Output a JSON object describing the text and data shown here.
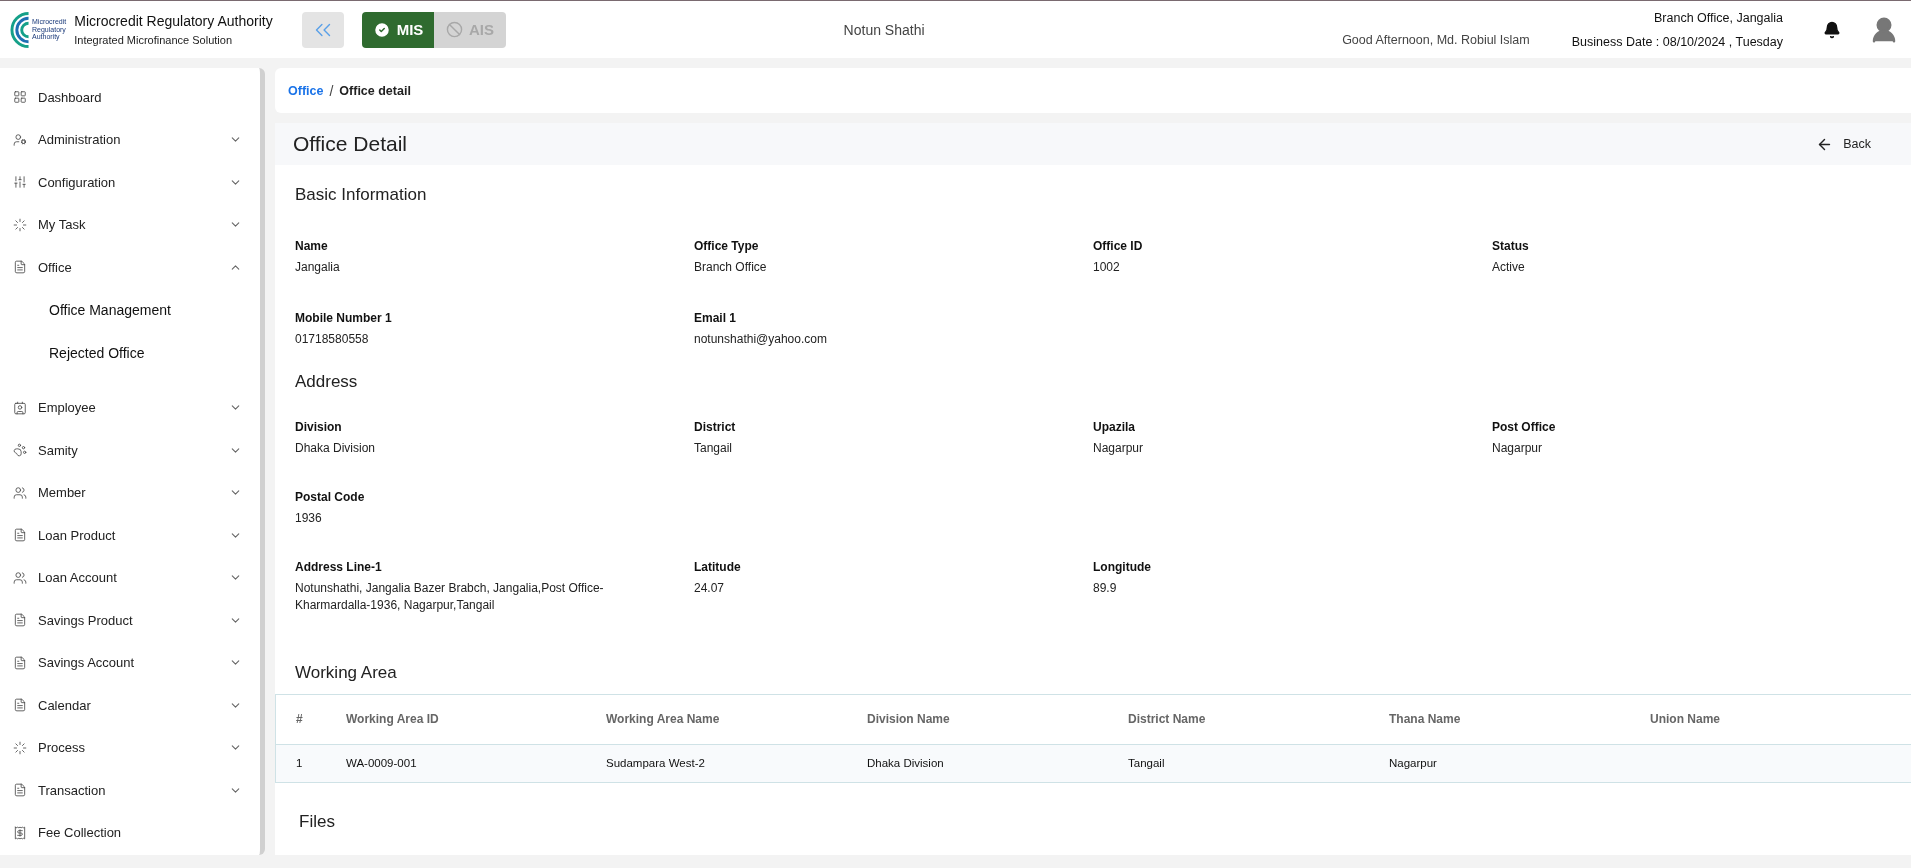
{
  "header": {
    "logo_title": "Microcredit Regulatory Authority",
    "logo_subtitle": "Integrated Microfinance Solution",
    "logo_mark_lines": [
      "Microcredit",
      "Regulatory",
      "Authority"
    ],
    "module_tabs": [
      {
        "label": "MIS",
        "selected": true
      },
      {
        "label": "AIS",
        "selected": false
      }
    ],
    "org_name": "Notun Shathi",
    "greeting": "Good Afternoon, Md. Robiul Islam",
    "branch": "Branch Office, Jangalia",
    "business_date": "Business Date : 08/10/2024 , Tuesday"
  },
  "sidebar": {
    "items": [
      {
        "label": "Dashboard",
        "kind": "link"
      },
      {
        "label": "Administration",
        "kind": "group",
        "expanded": false
      },
      {
        "label": "Configuration",
        "kind": "group",
        "expanded": false
      },
      {
        "label": "My Task",
        "kind": "group",
        "expanded": false
      },
      {
        "label": "Office",
        "kind": "group",
        "expanded": true,
        "children": [
          {
            "label": "Office Management"
          },
          {
            "label": "Rejected Office"
          }
        ]
      },
      {
        "label": "Employee",
        "kind": "group",
        "expanded": false
      },
      {
        "label": "Samity",
        "kind": "group",
        "expanded": false
      },
      {
        "label": "Member",
        "kind": "group",
        "expanded": false
      },
      {
        "label": "Loan Product",
        "kind": "group",
        "expanded": false
      },
      {
        "label": "Loan Account",
        "kind": "group",
        "expanded": false
      },
      {
        "label": "Savings Product",
        "kind": "group",
        "expanded": false
      },
      {
        "label": "Savings Account",
        "kind": "group",
        "expanded": false
      },
      {
        "label": "Calendar",
        "kind": "group",
        "expanded": false
      },
      {
        "label": "Process",
        "kind": "group",
        "expanded": false
      },
      {
        "label": "Transaction",
        "kind": "group",
        "expanded": false
      },
      {
        "label": "Fee Collection",
        "kind": "link"
      }
    ]
  },
  "breadcrumb": [
    {
      "label": "Office",
      "kind": "link"
    },
    {
      "label": "Office detail",
      "kind": "current"
    }
  ],
  "breadcrumb_separator": "/",
  "page": {
    "title": "Office Detail",
    "back_label": "Back"
  },
  "sections": [
    {
      "title": "Basic Information",
      "rows": [
        [
          {
            "label": "Name",
            "value": "Jangalia"
          },
          {
            "label": "Office Type",
            "value": "Branch Office"
          },
          {
            "label": "Office ID",
            "value": "1002"
          },
          {
            "label": "Status",
            "value": "Active"
          }
        ],
        [
          {
            "label": "Mobile Number 1",
            "value": "01718580558"
          },
          {
            "label": "Email 1",
            "value": "notunshathi@yahoo.com"
          }
        ]
      ]
    },
    {
      "title": "Address",
      "rows": [
        [
          {
            "label": "Division",
            "value": "Dhaka Division"
          },
          {
            "label": "District",
            "value": "Tangail"
          },
          {
            "label": "Upazila",
            "value": "Nagarpur"
          },
          {
            "label": "Post Office",
            "value": "Nagarpur"
          }
        ],
        [
          {
            "label": "Postal Code",
            "value": "1936"
          }
        ],
        [
          {
            "label": "Address Line-1",
            "value": "Notunshathi, Jangalia Bazer Brabch, Jangalia,Post Office-Kharmardalla-1936, Nagarpur,Tangail"
          },
          {
            "label": "Latitude",
            "value": "24.07"
          },
          {
            "label": "Longitude",
            "value": "89.9"
          }
        ]
      ]
    }
  ],
  "working_area": {
    "title": "Working Area",
    "columns": [
      "#",
      "Working Area ID",
      "Working Area Name",
      "Division Name",
      "District Name",
      "Thana Name",
      "Union Name"
    ],
    "rows": [
      [
        "1",
        "WA-0009-001",
        "Sudampara West-2",
        "Dhaka Division",
        "Tangail",
        "Nagarpur",
        ""
      ]
    ]
  },
  "files": {
    "title": "Files"
  }
}
